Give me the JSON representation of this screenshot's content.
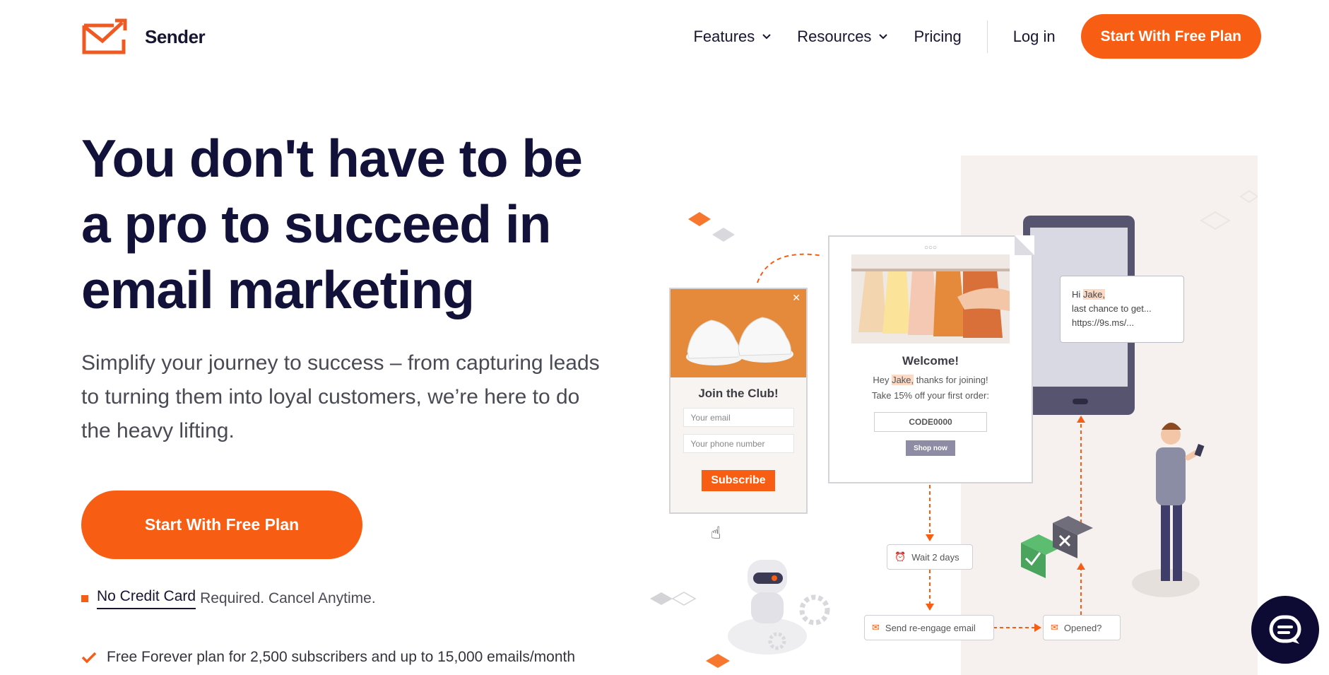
{
  "header": {
    "brand": "Sender",
    "nav": [
      {
        "label": "Features",
        "has_dropdown": true
      },
      {
        "label": "Resources",
        "has_dropdown": true
      },
      {
        "label": "Pricing",
        "has_dropdown": false
      }
    ],
    "login_label": "Log in",
    "cta_label": "Start With Free Plan"
  },
  "hero": {
    "title_lines": [
      "You don't have to be",
      "a pro to succeed in",
      "email marketing"
    ],
    "subtitle_lines": [
      "Simplify your journey to success – from capturing leads",
      "to turning them into loyal customers, we’re here to do",
      "the heavy lifting."
    ],
    "cta_label": "Start With Free Plan",
    "note_underlined": "No Credit Card",
    "note_rest": "Required. Cancel Anytime.",
    "feature": "Free Forever plan for 2,500 subscribers and up to 15,000 emails/month"
  },
  "illustration": {
    "popup": {
      "title": "Join the Club!",
      "email_placeholder": "Your email",
      "phone_placeholder": "Your phone number",
      "button": "Subscribe"
    },
    "email": {
      "heading": "Welcome!",
      "line1_pre": "Hey ",
      "line1_name": "Jake,",
      "line1_post": " thanks for joining!",
      "line2": "Take 15% off your first order:",
      "code": "CODE0000",
      "button": "Shop now"
    },
    "sms": {
      "greeting_pre": "Hi ",
      "greeting_name": "Jake,",
      "line2": "last chance to get...",
      "line3": "https://9s.ms/..."
    },
    "flow": {
      "wait": "Wait 2 days",
      "send": "Send re-engage email",
      "opened": "Opened?"
    }
  },
  "colors": {
    "accent": "#f85d14",
    "heading": "#12113a",
    "text": "#4a4a55",
    "chat_bg": "#0d0b33"
  },
  "icons": [
    "sender-logo-icon",
    "chevron-down-icon",
    "check-icon",
    "chat-icon",
    "alarm-icon",
    "envelope-icon",
    "close-icon",
    "cursor-hand-icon"
  ]
}
